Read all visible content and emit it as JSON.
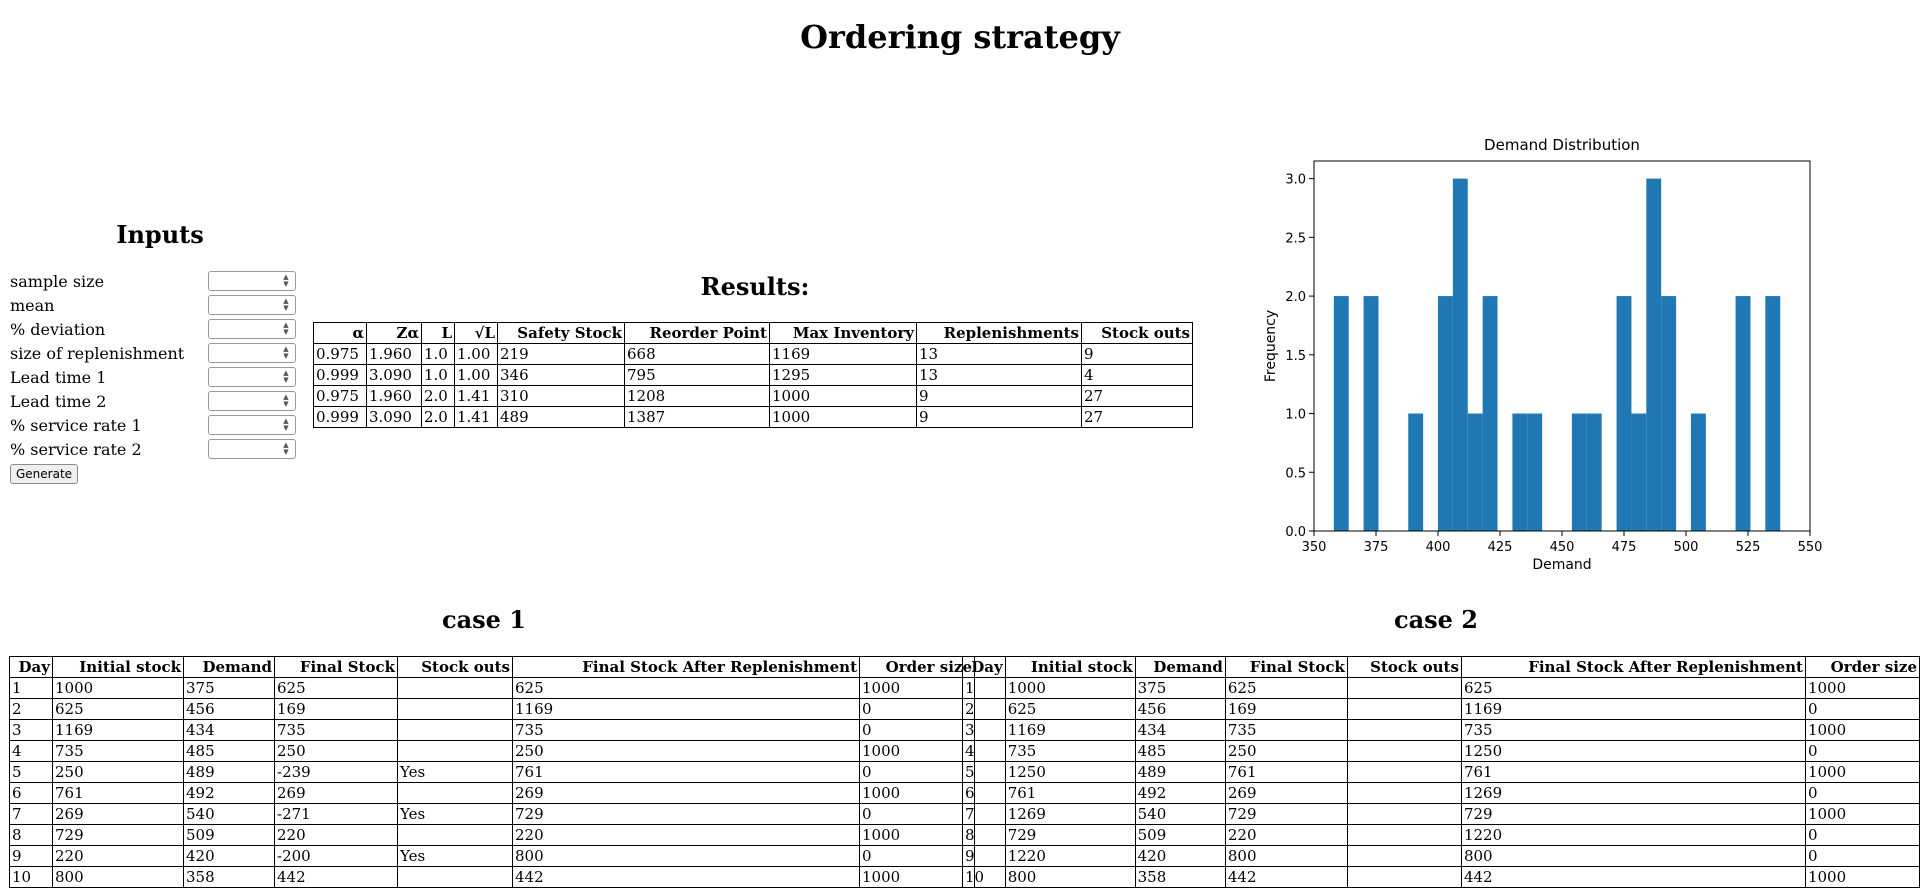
{
  "page": {
    "title": "Ordering strategy"
  },
  "inputs": {
    "title": "Inputs",
    "fields": [
      {
        "label": "sample size",
        "value": ""
      },
      {
        "label": "mean",
        "value": ""
      },
      {
        "label": "% deviation",
        "value": ""
      },
      {
        "label": "size of replenishment",
        "value": ""
      },
      {
        "label": "Lead time 1",
        "value": ""
      },
      {
        "label": "Lead time 2",
        "value": ""
      },
      {
        "label": "% service rate 1",
        "value": ""
      },
      {
        "label": "% service rate 2",
        "value": ""
      }
    ],
    "generate_label": "Generate"
  },
  "results": {
    "title": "Results:",
    "headers": [
      "α",
      "Zα",
      "L",
      "√L",
      "Safety Stock",
      "Reorder Point",
      "Max Inventory",
      "Replenishments",
      "Stock outs"
    ],
    "rows": [
      [
        "0.975",
        "1.960",
        "1.0",
        "1.00",
        "219",
        "668",
        "1169",
        "13",
        "9"
      ],
      [
        "0.999",
        "3.090",
        "1.0",
        "1.00",
        "346",
        "795",
        "1295",
        "13",
        "4"
      ],
      [
        "0.975",
        "1.960",
        "2.0",
        "1.41",
        "310",
        "1208",
        "1000",
        "9",
        "27"
      ],
      [
        "0.999",
        "3.090",
        "2.0",
        "1.41",
        "489",
        "1387",
        "1000",
        "9",
        "27"
      ]
    ]
  },
  "case1": {
    "title": "case 1",
    "headers": [
      "Day",
      "Initial stock",
      "Demand",
      "Final Stock",
      "Stock outs",
      "Final Stock After Replenishment",
      "Order size"
    ],
    "rows": [
      [
        "1",
        "1000",
        "375",
        "625",
        "",
        "625",
        "1000"
      ],
      [
        "2",
        "625",
        "456",
        "169",
        "",
        "1169",
        "0"
      ],
      [
        "3",
        "1169",
        "434",
        "735",
        "",
        "735",
        "0"
      ],
      [
        "4",
        "735",
        "485",
        "250",
        "",
        "250",
        "1000"
      ],
      [
        "5",
        "250",
        "489",
        "-239",
        "Yes",
        "761",
        "0"
      ],
      [
        "6",
        "761",
        "492",
        "269",
        "",
        "269",
        "1000"
      ],
      [
        "7",
        "269",
        "540",
        "-271",
        "Yes",
        "729",
        "0"
      ],
      [
        "8",
        "729",
        "509",
        "220",
        "",
        "220",
        "1000"
      ],
      [
        "9",
        "220",
        "420",
        "-200",
        "Yes",
        "800",
        "0"
      ],
      [
        "10",
        "800",
        "358",
        "442",
        "",
        "442",
        "1000"
      ]
    ]
  },
  "case2": {
    "title": "case 2",
    "headers": [
      "Day",
      "Initial stock",
      "Demand",
      "Final Stock",
      "Stock outs",
      "Final Stock After Replenishment",
      "Order size"
    ],
    "rows": [
      [
        "1",
        "1000",
        "375",
        "625",
        "",
        "625",
        "1000"
      ],
      [
        "2",
        "625",
        "456",
        "169",
        "",
        "1169",
        "0"
      ],
      [
        "3",
        "1169",
        "434",
        "735",
        "",
        "735",
        "1000"
      ],
      [
        "4",
        "735",
        "485",
        "250",
        "",
        "1250",
        "0"
      ],
      [
        "5",
        "1250",
        "489",
        "761",
        "",
        "761",
        "1000"
      ],
      [
        "6",
        "761",
        "492",
        "269",
        "",
        "1269",
        "0"
      ],
      [
        "7",
        "1269",
        "540",
        "729",
        "",
        "729",
        "1000"
      ],
      [
        "8",
        "729",
        "509",
        "220",
        "",
        "1220",
        "0"
      ],
      [
        "9",
        "1220",
        "420",
        "800",
        "",
        "800",
        "0"
      ],
      [
        "10",
        "800",
        "358",
        "442",
        "",
        "442",
        "1000"
      ]
    ]
  },
  "chart_data": {
    "type": "bar",
    "title": "Demand Distribution",
    "xlabel": "Demand",
    "ylabel": "Frequency",
    "xlim": [
      350,
      550
    ],
    "ylim": [
      0,
      3.15
    ],
    "x_ticks": [
      350,
      375,
      400,
      425,
      450,
      475,
      500,
      525,
      550
    ],
    "y_ticks": [
      "0.0",
      "0.5",
      "1.0",
      "1.5",
      "2.0",
      "2.5",
      "3.0"
    ],
    "bar_color": "#1f77b4",
    "bin_width": 6,
    "bins": [
      {
        "x0": 358,
        "count": 2
      },
      {
        "x0": 370,
        "count": 2
      },
      {
        "x0": 388,
        "count": 1
      },
      {
        "x0": 400,
        "count": 2
      },
      {
        "x0": 406,
        "count": 3
      },
      {
        "x0": 412,
        "count": 1
      },
      {
        "x0": 418,
        "count": 2
      },
      {
        "x0": 430,
        "count": 1
      },
      {
        "x0": 436,
        "count": 1
      },
      {
        "x0": 454,
        "count": 1
      },
      {
        "x0": 460,
        "count": 1
      },
      {
        "x0": 472,
        "count": 2
      },
      {
        "x0": 478,
        "count": 1
      },
      {
        "x0": 484,
        "count": 3
      },
      {
        "x0": 490,
        "count": 2
      },
      {
        "x0": 502,
        "count": 1
      },
      {
        "x0": 520,
        "count": 2
      },
      {
        "x0": 532,
        "count": 2
      }
    ]
  }
}
